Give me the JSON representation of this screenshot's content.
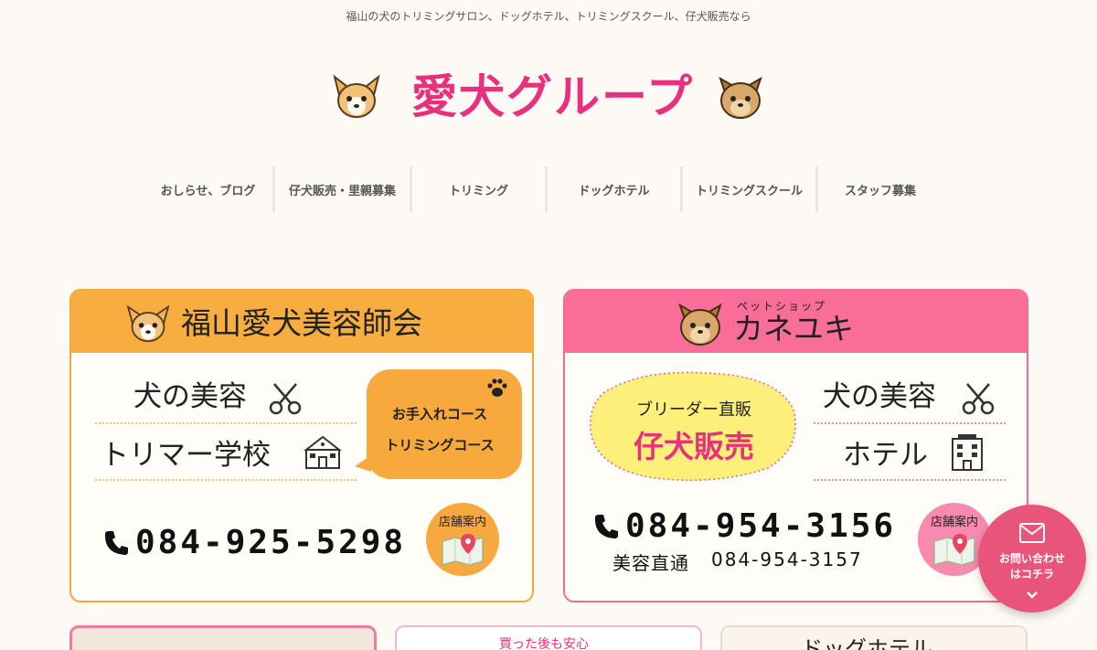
{
  "header": {
    "tagline": "福山の犬のトリミングサロン、ドッグホテル、トリミングスクール、仔犬販売なら",
    "logo_text": "愛犬グループ"
  },
  "nav": {
    "items": [
      {
        "label": "おしらせ、ブログ"
      },
      {
        "label": "仔犬販売・里親募集"
      },
      {
        "label": "トリミング"
      },
      {
        "label": "ドッグホテル"
      },
      {
        "label": "トリミングスクール"
      },
      {
        "label": "スタッフ募集"
      }
    ]
  },
  "left_card": {
    "title": "福山愛犬美容師会",
    "services": [
      "犬の美容",
      "トリマー学校"
    ],
    "bubble": [
      "お手入れコース",
      "トリミングコース"
    ],
    "phone": "084-925-5298",
    "store_label": "店舗案内"
  },
  "right_card": {
    "ruby": "ペットショップ",
    "title": "カネユキ",
    "sale_sub": "ブリーダー直販",
    "sale_main": "仔犬販売",
    "services": [
      "犬の美容",
      "ホテル"
    ],
    "phone": "084-954-3156",
    "sub_phone_label": "美容直通",
    "sub_phone": "084-954-3157",
    "store_label": "店舗案内"
  },
  "contact_button": {
    "line1": "お問い合わせ",
    "line2": "はコチラ"
  },
  "bottom": {
    "middle_text": "買った後も安心",
    "right_text": "ドッグホテル"
  },
  "colors": {
    "brand_pink": "#e8307c",
    "orange": "#f7ad3f",
    "pink": "#f86e99",
    "background": "#fdf9f5"
  }
}
